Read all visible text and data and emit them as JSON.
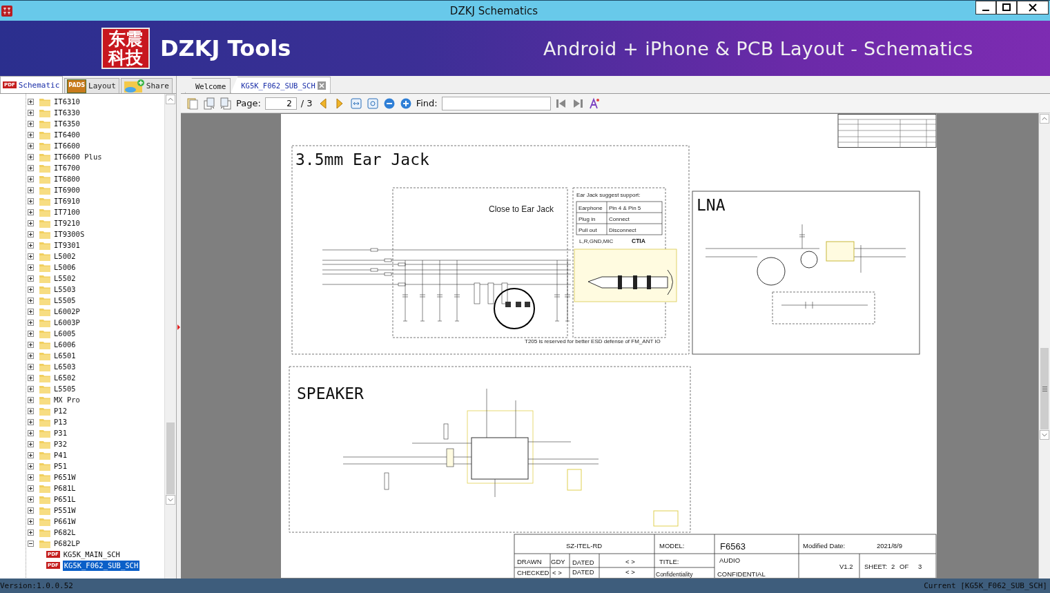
{
  "window": {
    "title": "DZKJ Schematics"
  },
  "banner": {
    "logo_lines": [
      "东震",
      "科技"
    ],
    "brand": "DZKJ Tools",
    "tagline": "Android + iPhone & PCB Layout - Schematics"
  },
  "app_tabs": [
    {
      "label": "Schematic",
      "kind": "pdf",
      "icon_text": "PDF",
      "selected": true
    },
    {
      "label": "Layout",
      "kind": "pads",
      "icon_text": "PADS",
      "selected": false
    },
    {
      "label": "Share",
      "kind": "cloud",
      "selected": false
    }
  ],
  "doc_tabs": [
    {
      "label": "Welcome",
      "selected": false,
      "closable": false
    },
    {
      "label": "KG5K_F062_SUB_SCH",
      "selected": true,
      "closable": true
    }
  ],
  "toolbar": {
    "page_label": "Page:",
    "page_value": "2",
    "page_total": "/ 3",
    "find_label": "Find:"
  },
  "tree": [
    {
      "label": "IT6310",
      "expanded": false
    },
    {
      "label": "IT6330",
      "expanded": false
    },
    {
      "label": "IT6350",
      "expanded": false
    },
    {
      "label": "IT6400",
      "expanded": false
    },
    {
      "label": "IT6600",
      "expanded": false
    },
    {
      "label": "IT6600 Plus",
      "expanded": false
    },
    {
      "label": "IT6700",
      "expanded": false
    },
    {
      "label": "IT6800",
      "expanded": false
    },
    {
      "label": "IT6900",
      "expanded": false
    },
    {
      "label": "IT6910",
      "expanded": false
    },
    {
      "label": "IT7100",
      "expanded": false
    },
    {
      "label": "IT9210",
      "expanded": false
    },
    {
      "label": "IT9300S",
      "expanded": false
    },
    {
      "label": "IT9301",
      "expanded": false
    },
    {
      "label": "L5002",
      "expanded": false
    },
    {
      "label": "L5006",
      "expanded": false
    },
    {
      "label": "L5502",
      "expanded": false
    },
    {
      "label": "L5503",
      "expanded": false
    },
    {
      "label": "L5505",
      "expanded": false
    },
    {
      "label": "L6002P",
      "expanded": false
    },
    {
      "label": "L6003P",
      "expanded": false
    },
    {
      "label": "L6005",
      "expanded": false
    },
    {
      "label": "L6006",
      "expanded": false
    },
    {
      "label": "L6501",
      "expanded": false
    },
    {
      "label": "L6503",
      "expanded": false
    },
    {
      "label": "L6502",
      "expanded": false
    },
    {
      "label": "L5505",
      "expanded": false
    },
    {
      "label": "MX Pro",
      "expanded": false
    },
    {
      "label": "P12",
      "expanded": false
    },
    {
      "label": "P13",
      "expanded": false
    },
    {
      "label": "P31",
      "expanded": false
    },
    {
      "label": "P32",
      "expanded": false
    },
    {
      "label": "P41",
      "expanded": false
    },
    {
      "label": "P51",
      "expanded": false
    },
    {
      "label": "P651W",
      "expanded": false
    },
    {
      "label": "P681L",
      "expanded": false
    },
    {
      "label": "P651L",
      "expanded": false
    },
    {
      "label": "P551W",
      "expanded": false
    },
    {
      "label": "P661W",
      "expanded": false
    },
    {
      "label": "P682L",
      "expanded": false
    },
    {
      "label": "P682LP",
      "expanded": true,
      "children": [
        {
          "label": "KG5K_MAIN_SCH",
          "icon_text": "PDF",
          "selected": false
        },
        {
          "label": "KG5K_F062_SUB_SCH",
          "icon_text": "PDF",
          "selected": true
        }
      ]
    }
  ],
  "schematic": {
    "sections": [
      {
        "kind": "ear_jack",
        "title": "3.5mm Ear Jack"
      },
      {
        "kind": "lna",
        "title": "LNA"
      },
      {
        "kind": "speaker",
        "title": "SPEAKER"
      }
    ],
    "ear_jack_note": "Close to Ear Jack",
    "support": {
      "heading": "Ear Jack suggest support:",
      "rows": [
        [
          "Earphone",
          "Pin 4 & Pin 5"
        ],
        [
          "Plug in",
          "Connect"
        ],
        [
          "Pull out",
          "Disconnect"
        ]
      ],
      "pins": "L,R,GND,MIC",
      "standard": "CTIA"
    },
    "esd_note": "T205 is reserved for better ESD defense of FM_ANT IO",
    "title_block": {
      "company": "SZ-ITEL-RD",
      "model_label": "MODEL:",
      "model": "F6563",
      "modified_label": "Modified Date:",
      "modified": "2021/8/9",
      "drawn_label": "DRAWN",
      "drawn": "GDY",
      "dated_label": "DATED",
      "dated": "< >",
      "title_label": "TITLE:",
      "title": "AUDIO",
      "checked_label": "CHECKED",
      "checked": "< >",
      "dated2_label": "DATED",
      "dated2": "< >",
      "conf_label": "Confidentiality",
      "conf": "CONFIDENTIAL",
      "version": "V1.2",
      "sheet_label": "SHEET:",
      "sheet": "2",
      "of_label": "OF",
      "total": "3"
    }
  },
  "status_bar": {
    "version": "Version:1.0.0.52",
    "current": "Current [KG5K_F062_SUB_SCH]"
  }
}
